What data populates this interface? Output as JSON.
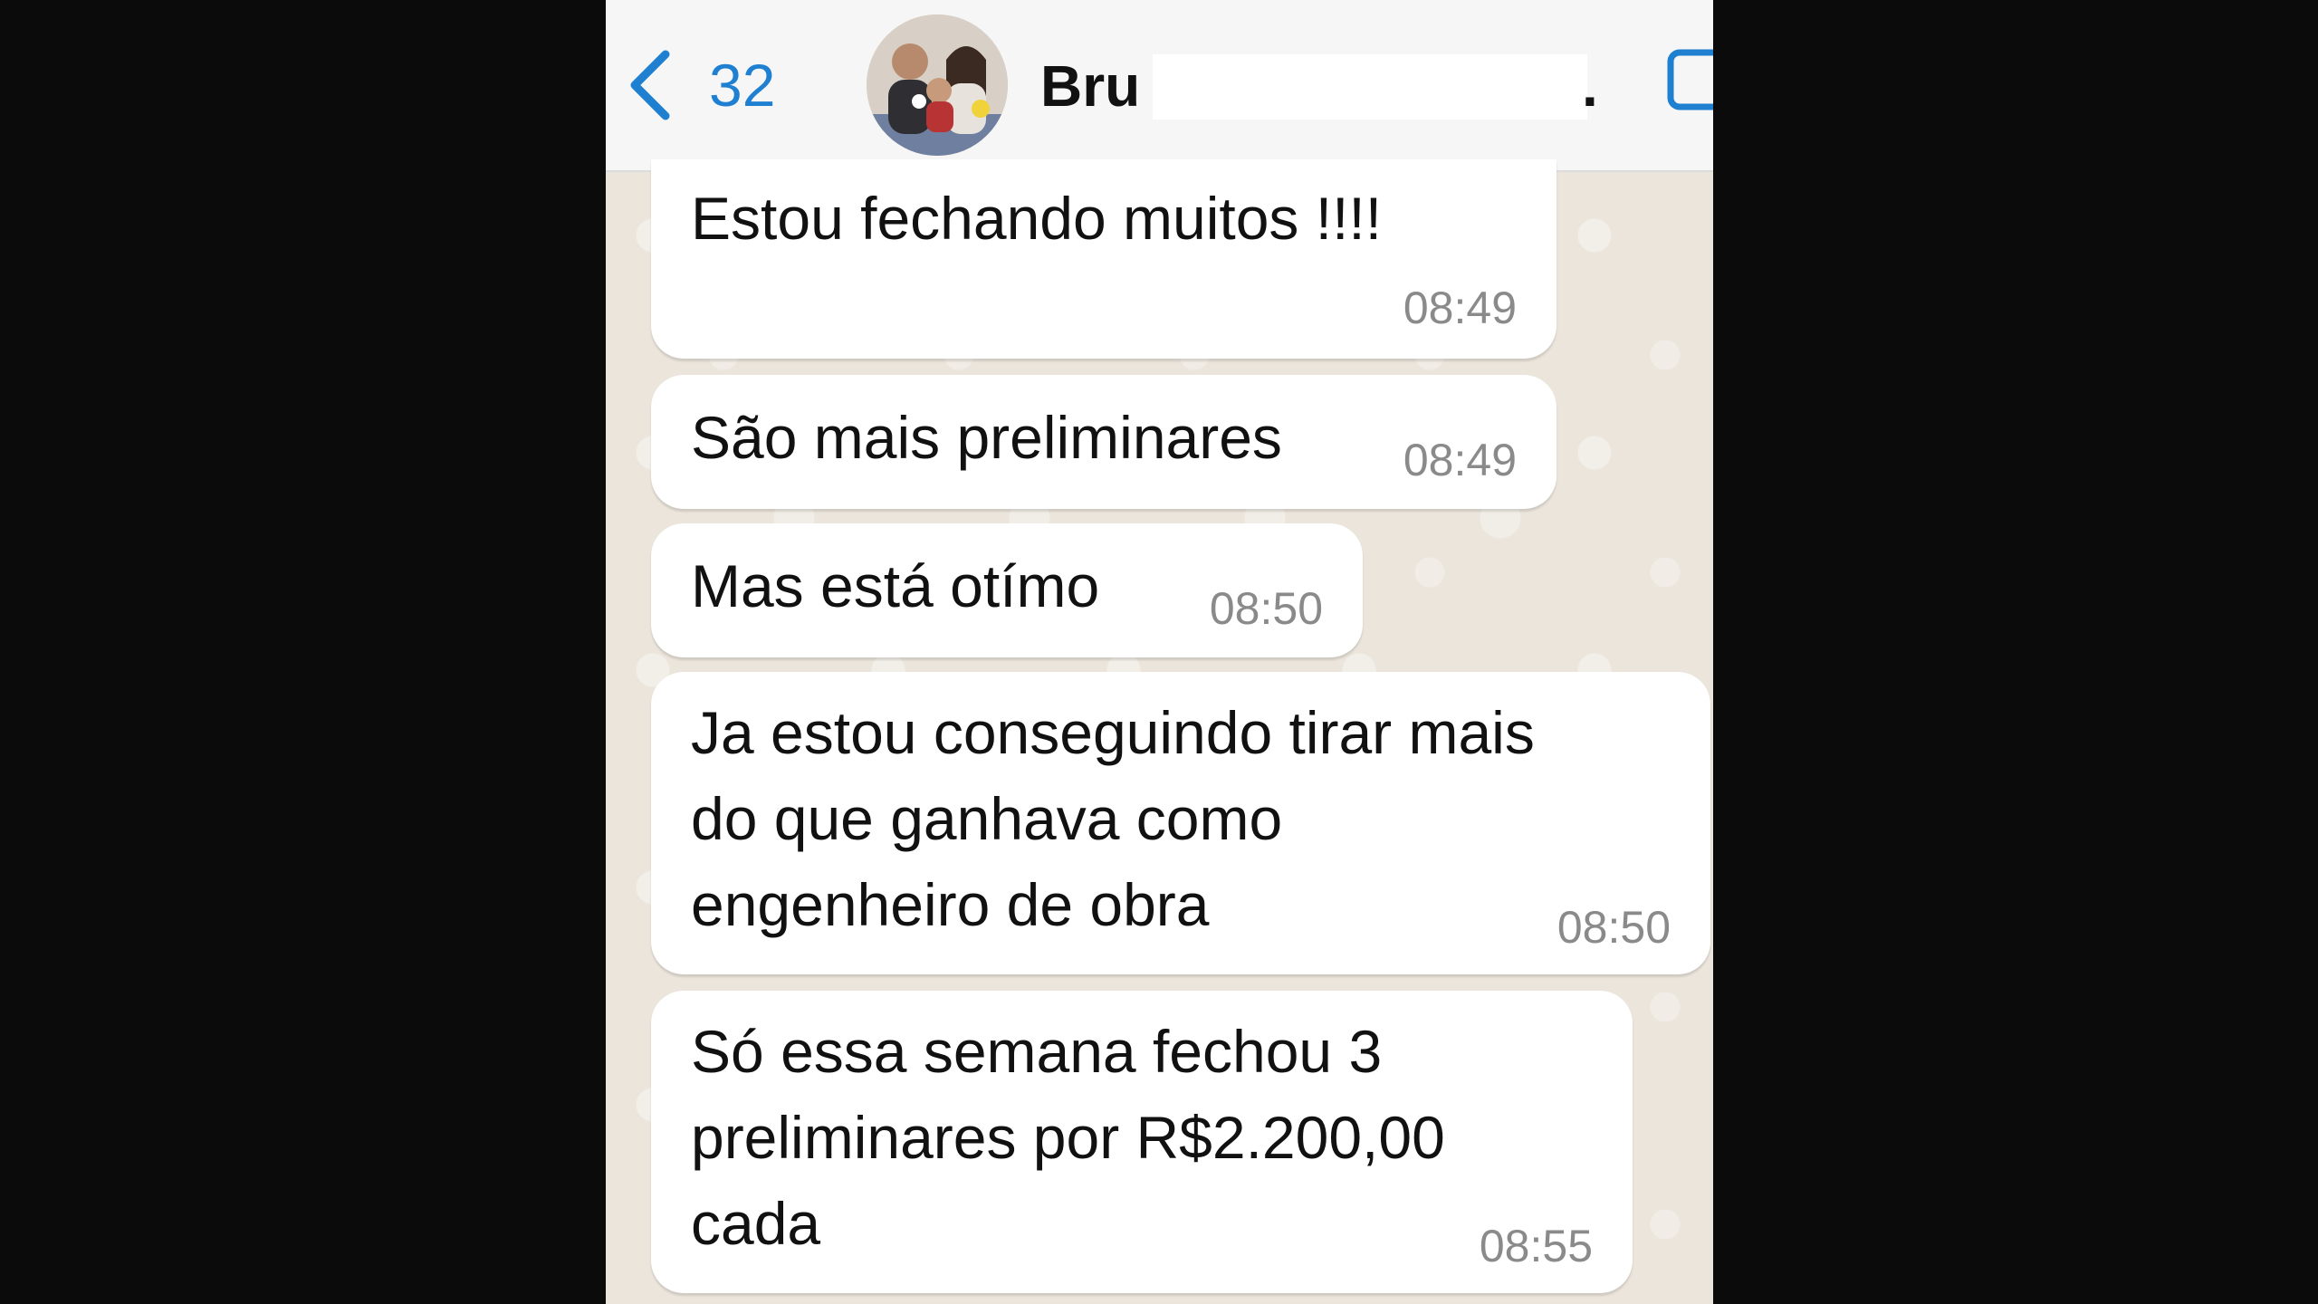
{
  "header": {
    "back_count": "32",
    "contact_name": "Bru",
    "name_trailing": "."
  },
  "messages": [
    {
      "text": "Estou fechando muitos !!!!",
      "time": "08:49"
    },
    {
      "text": "São mais preliminares",
      "time": "08:49"
    },
    {
      "text": "Mas está otímo",
      "time": "08:50"
    },
    {
      "lines": [
        "Ja estou conseguindo tirar mais",
        "do que ganhava como",
        "engenheiro de obra"
      ],
      "time": "08:50"
    },
    {
      "lines": [
        "Só essa semana fechou 3",
        "preliminares por R$2.200,00",
        "cada"
      ],
      "time": "08:55"
    }
  ],
  "icons": {
    "back": "chevron-left-icon",
    "video": "video-call-icon"
  },
  "colors": {
    "accent": "#1f7fd1",
    "header_bg": "#f6f6f6",
    "chat_bg": "#ebe5dc",
    "bubble_bg": "#ffffff",
    "time_text": "#8a8a8a"
  }
}
